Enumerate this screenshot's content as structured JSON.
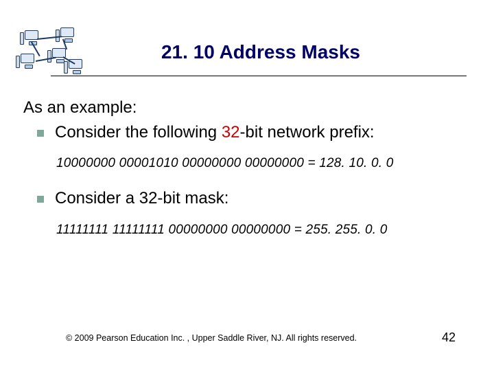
{
  "title": "21. 10  Address Masks",
  "intro": "As an example:",
  "bullets": {
    "b1_a": "Consider the following ",
    "b1_accent": "32",
    "b1_b": "-bit network prefix:",
    "b2": "Consider a 32-bit mask:"
  },
  "lines": {
    "prefix": "10000000   00001010   00000000   00000000 = 128. 10. 0. 0",
    "mask": "11111111   11111111   00000000   00000000 = 255. 255. 0. 0"
  },
  "footer": {
    "copyright": "© 2009 Pearson Education Inc. , Upper Saddle River, NJ. All rights reserved.",
    "page": "42"
  },
  "icon_name": "network-computers-icon"
}
